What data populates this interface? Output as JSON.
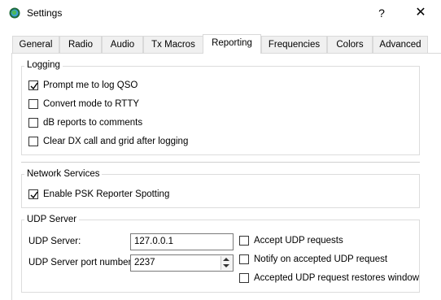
{
  "window": {
    "title": "Settings",
    "help_glyph": "?",
    "close_glyph": "✕"
  },
  "tabs": [
    {
      "label": "General"
    },
    {
      "label": "Radio"
    },
    {
      "label": "Audio"
    },
    {
      "label": "Tx Macros"
    },
    {
      "label": "Reporting",
      "active": true
    },
    {
      "label": "Frequencies"
    },
    {
      "label": "Colors"
    },
    {
      "label": "Advanced"
    }
  ],
  "logging": {
    "title": "Logging",
    "options": [
      {
        "label": "Prompt me to log QSO",
        "checked": true
      },
      {
        "label": "Convert mode to RTTY",
        "checked": false
      },
      {
        "label": "dB reports to comments",
        "checked": false
      },
      {
        "label": "Clear DX call and grid after logging",
        "checked": false
      }
    ]
  },
  "network": {
    "title": "Network Services",
    "options": [
      {
        "label": "Enable PSK Reporter Spotting",
        "checked": true
      }
    ]
  },
  "udp": {
    "title": "UDP Server",
    "server_label": "UDP Server:",
    "server_value": "127.0.0.1",
    "port_label": "UDP Server port number:",
    "port_value": "2237",
    "options": [
      {
        "label": "Accept UDP requests",
        "checked": false
      },
      {
        "label": "Notify on accepted UDP request",
        "checked": false
      },
      {
        "label": "Accepted UDP request restores window",
        "checked": false
      }
    ]
  },
  "colors": {
    "check": "#000000",
    "border": "#333333"
  }
}
